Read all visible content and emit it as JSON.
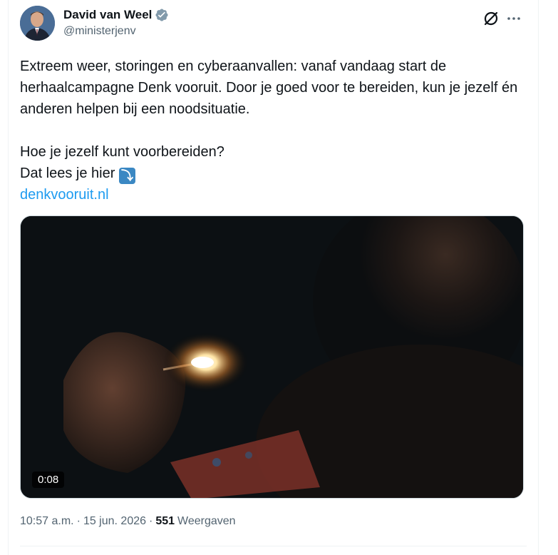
{
  "author": {
    "display_name": "David van Weel",
    "handle": "@ministerjenv",
    "verified": true
  },
  "icons": {
    "avatar": "avatar",
    "verified": "verified-badge-icon",
    "grok": "grok-icon",
    "more": "more-icon"
  },
  "tweet": {
    "paragraph1": "Extreem weer, storingen en cyberaanvallen: vanaf vandaag start de herhaalcampagne Denk vooruit. Door je goed voor te bereiden, kun je jezelf én anderen helpen bij een noodsituatie.",
    "line_question": "Hoe je jezelf kunt voorbereiden?",
    "line_read": "Dat lees je hier",
    "arrow_emoji": "⤵",
    "link_text": "denkvooruit.nl"
  },
  "media": {
    "type": "video",
    "duration": "0:08"
  },
  "meta": {
    "time": "10:57 a.m.",
    "separator1": "·",
    "date": "15 jun. 2026",
    "separator2": "·",
    "views_count": "551",
    "views_label": "Weergaven"
  },
  "colors": {
    "link": "#1d9bf0",
    "verified": "#829aab",
    "secondary_text": "#536471"
  }
}
